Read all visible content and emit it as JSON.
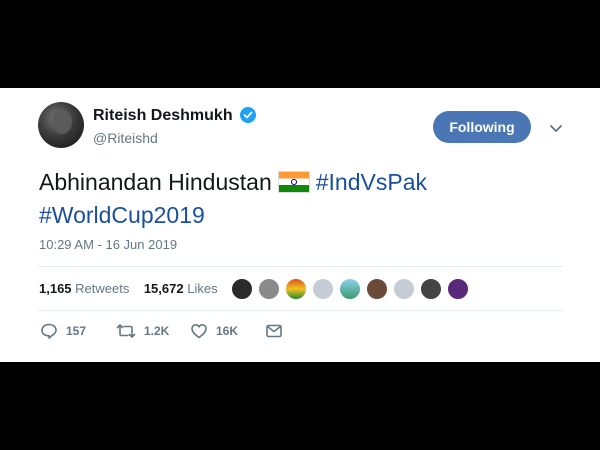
{
  "tweet": {
    "author_name": "Riteish Deshmukh",
    "author_handle": "@Riteishd",
    "follow_label": "Following",
    "text_plain_1": "Abhinandan Hindustan",
    "hashtag_1": "#IndVsPak",
    "hashtag_2": "#WorldCup2019",
    "timestamp": "10:29 AM - 16 Jun 2019",
    "retweets_count": "1,165",
    "retweets_label": "Retweets",
    "likes_count": "15,672",
    "likes_label": "Likes",
    "actions": {
      "reply_count": "157",
      "retweet_count": "1.2K",
      "like_count": "16K"
    }
  },
  "colors": {
    "link": "#1b4f9c",
    "follow_button": "#4a76b6",
    "verified": "#1da1f2",
    "secondary_text": "#657786"
  }
}
